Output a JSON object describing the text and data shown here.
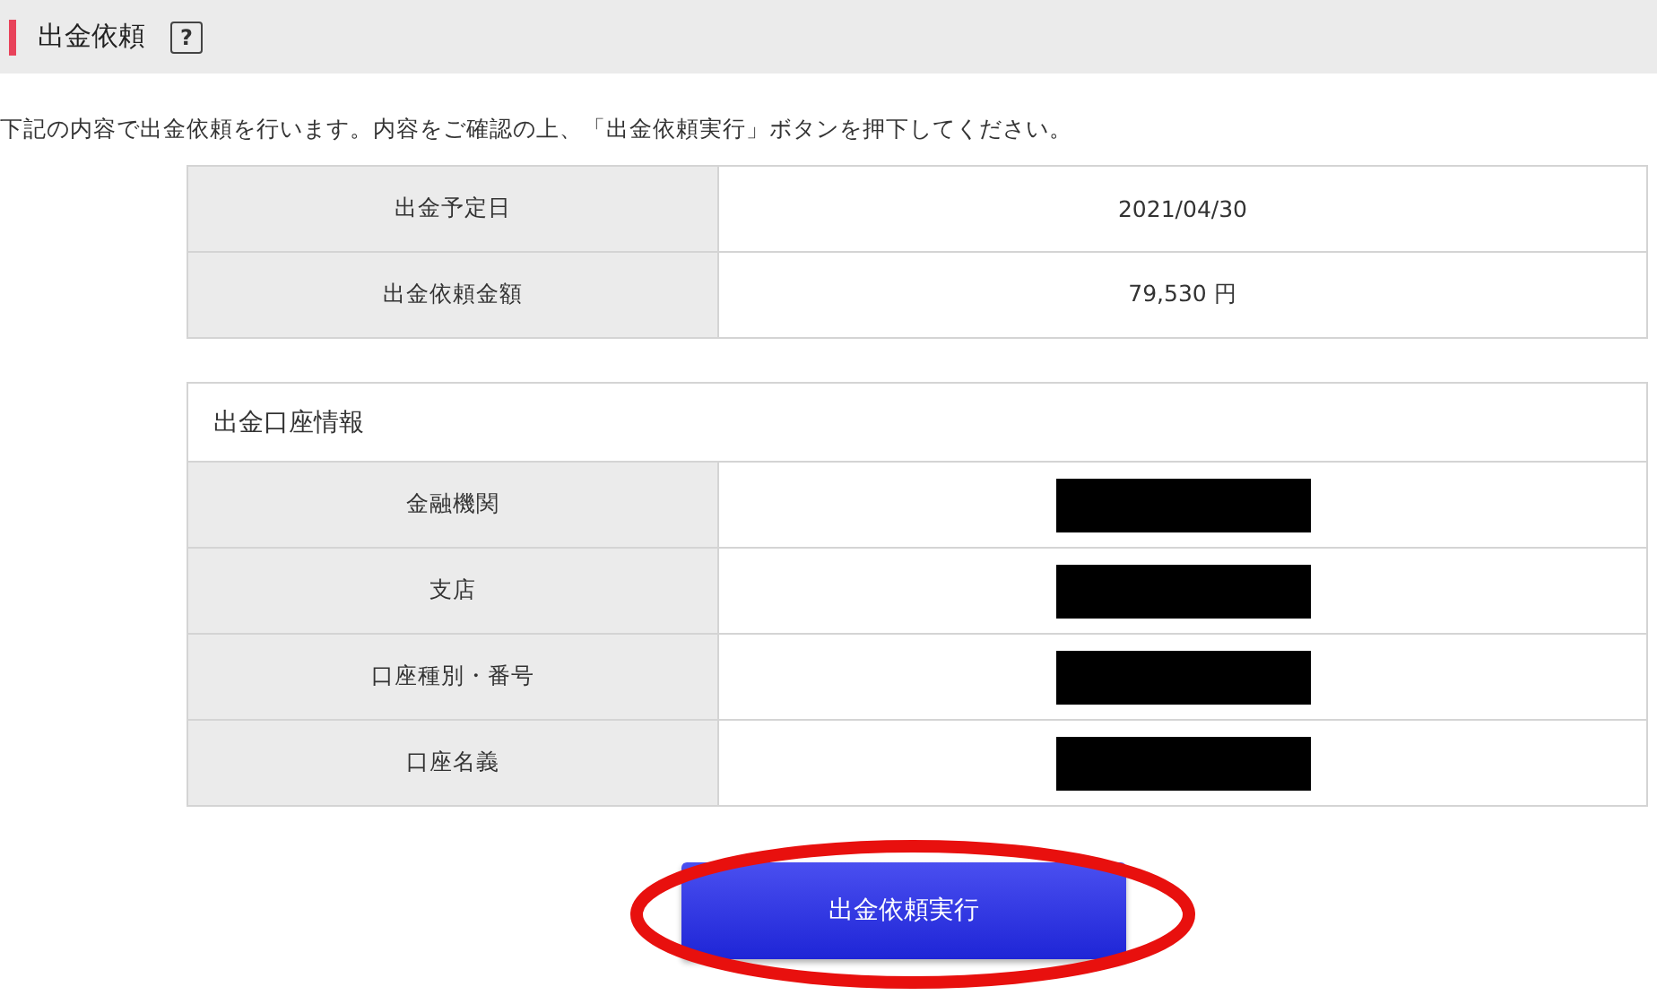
{
  "header": {
    "title": "出金依頼",
    "help_icon": "?"
  },
  "instruction": "下記の内容で出金依頼を行います。内容をご確認の上、「出金依頼実行」ボタンを押下してください。",
  "summary_rows": [
    {
      "label": "出金予定日",
      "value": "2021/04/30",
      "redacted": false
    },
    {
      "label": "出金依頼金額",
      "value": "79,530 円",
      "redacted": false
    }
  ],
  "account": {
    "title": "出金口座情報",
    "rows": [
      {
        "label": "金融機関",
        "redacted": true
      },
      {
        "label": "支店",
        "redacted": true
      },
      {
        "label": "口座種別・番号",
        "redacted": true
      },
      {
        "label": "口座名義",
        "redacted": true
      }
    ]
  },
  "submit_button": {
    "label": "出金依頼実行",
    "highlighted": true
  }
}
